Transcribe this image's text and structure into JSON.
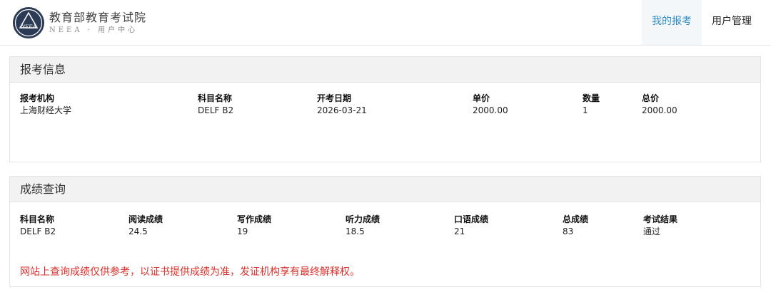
{
  "header": {
    "logo_mark_text": "NEEA",
    "logo_title": "教育部教育考试院",
    "logo_subtitle": "NEEA · 用户中心",
    "nav": [
      {
        "label": "我的报考",
        "active": true
      },
      {
        "label": "用户管理",
        "active": false
      }
    ]
  },
  "registration": {
    "title": "报考信息",
    "columns": [
      {
        "header": "报考机构",
        "value": "上海财经大学"
      },
      {
        "header": "科目名称",
        "value": "DELF B2"
      },
      {
        "header": "开考日期",
        "value": "2026-03-21"
      },
      {
        "header": "单价",
        "value": "2000.00"
      },
      {
        "header": "数量",
        "value": "1"
      },
      {
        "header": "总价",
        "value": "2000.00"
      }
    ]
  },
  "scores": {
    "title": "成绩查询",
    "columns": [
      {
        "header": "科目名称",
        "value": "DELF B2"
      },
      {
        "header": "阅读成绩",
        "value": "24.5"
      },
      {
        "header": "写作成绩",
        "value": "19"
      },
      {
        "header": "听力成绩",
        "value": "18.5"
      },
      {
        "header": "口语成绩",
        "value": "21"
      },
      {
        "header": "总成绩",
        "value": "83"
      },
      {
        "header": "考试结果",
        "value": "通过"
      }
    ],
    "notice": "网站上查询成绩仅供参考，以证书提供成绩为准，发证机构享有最终解释权。"
  },
  "colors": {
    "accent": "#2e8bc4",
    "notice": "#d9302b",
    "logo": "#2b3a55"
  }
}
